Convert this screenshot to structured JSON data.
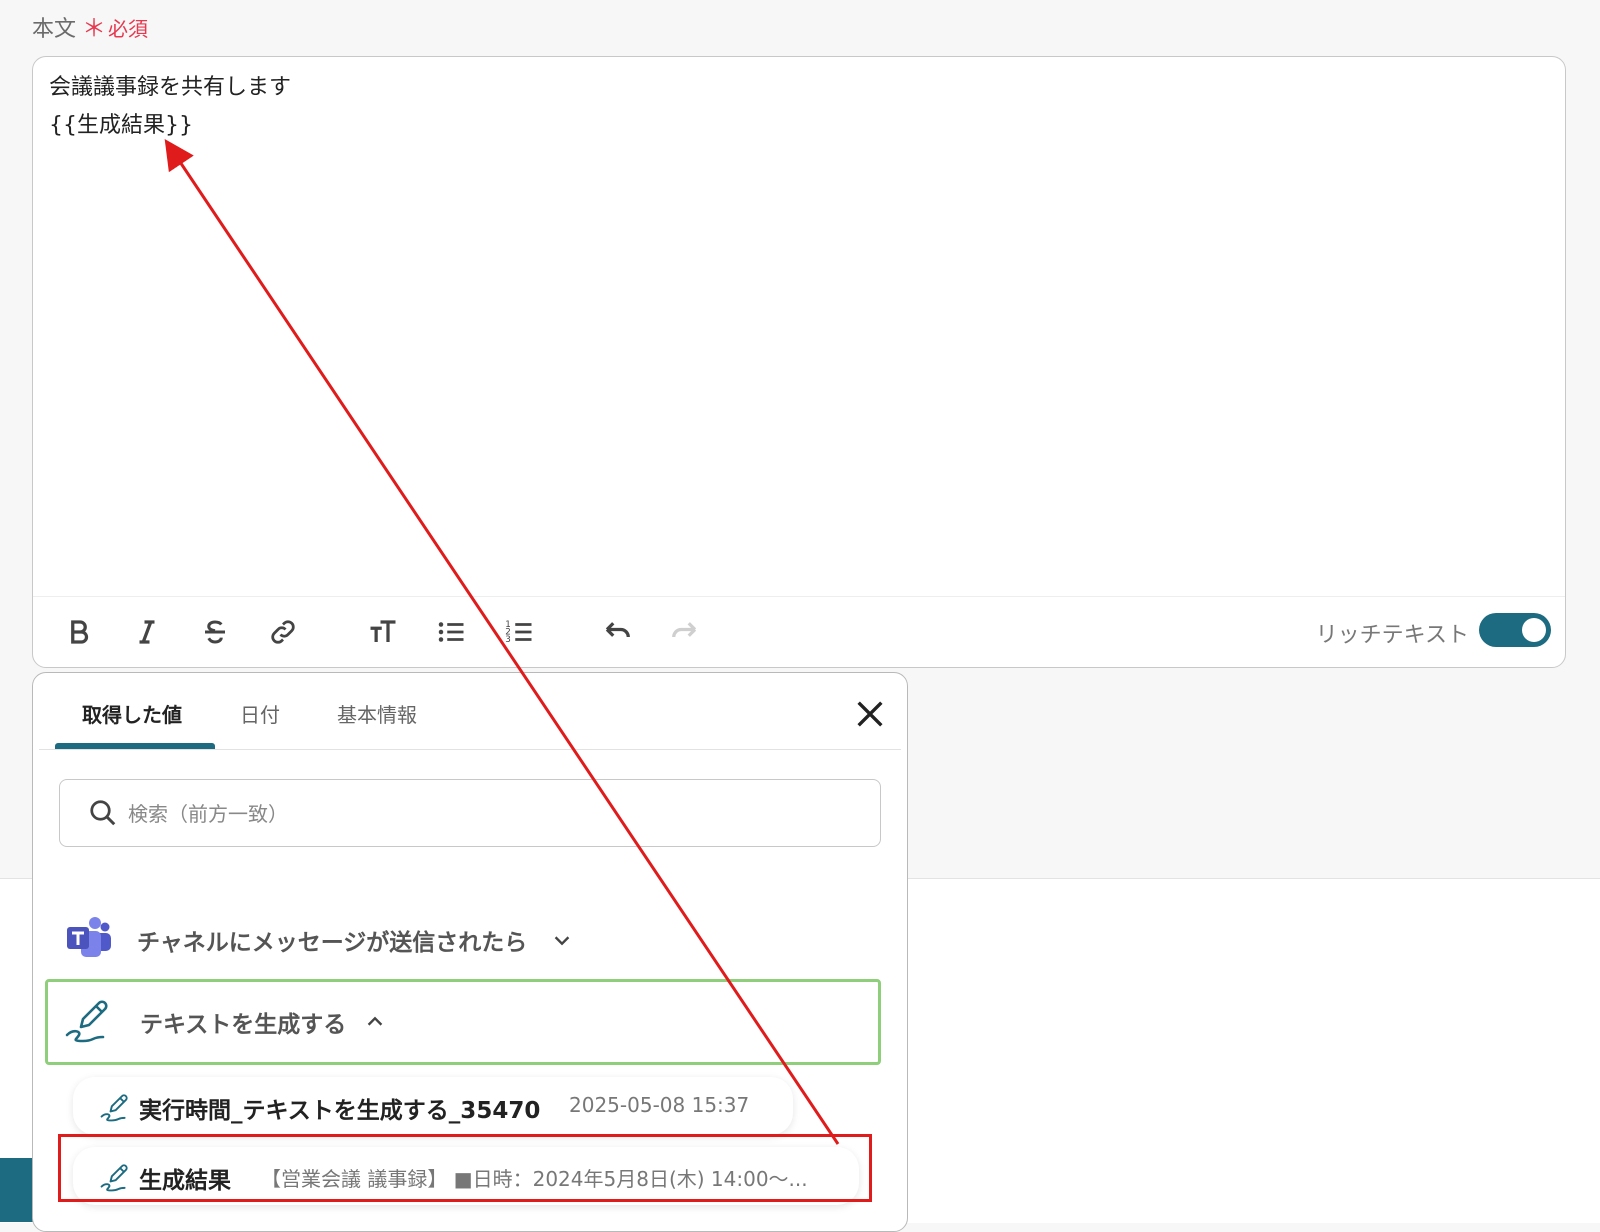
{
  "field": {
    "label": "本文",
    "required_star": "＊",
    "required_text": "必須"
  },
  "editor": {
    "lines": [
      "会議議事録を共有します",
      "{{生成結果}}"
    ],
    "toolbar": {
      "bold": "bold-icon",
      "italic": "italic-icon",
      "strike": "strikethrough-icon",
      "link": "link-icon",
      "font_size": "font-size-icon",
      "bullet_list": "bullet-list-icon",
      "numbered_list": "numbered-list-icon",
      "undo": "undo-icon",
      "redo": "redo-icon"
    },
    "rich_text_label": "リッチテキスト",
    "rich_text_on": true
  },
  "popup": {
    "tabs": [
      {
        "label": "取得した値",
        "active": true
      },
      {
        "label": "日付",
        "active": false
      },
      {
        "label": "基本情報",
        "active": false
      }
    ],
    "search_placeholder": "検索（前方一致）",
    "sections": [
      {
        "label": "チャネルにメッセージが送信されたら",
        "icon": "teams-icon",
        "expanded": false
      },
      {
        "label": "テキストを生成する",
        "icon": "ai-pen-icon",
        "expanded": true
      }
    ],
    "items": [
      {
        "name": "実行時間_テキストを生成する_35470",
        "value": "2025-05-08 15:37"
      },
      {
        "name": "生成結果",
        "value": "【営業会議 議事録】 ■日時：2024年5月8日(木) 14:00〜..."
      }
    ]
  },
  "colors": {
    "accent": "#1c6b80",
    "required": "#e8384f",
    "highlight": "#e01b1b",
    "section_border": "#8fcf7c"
  }
}
